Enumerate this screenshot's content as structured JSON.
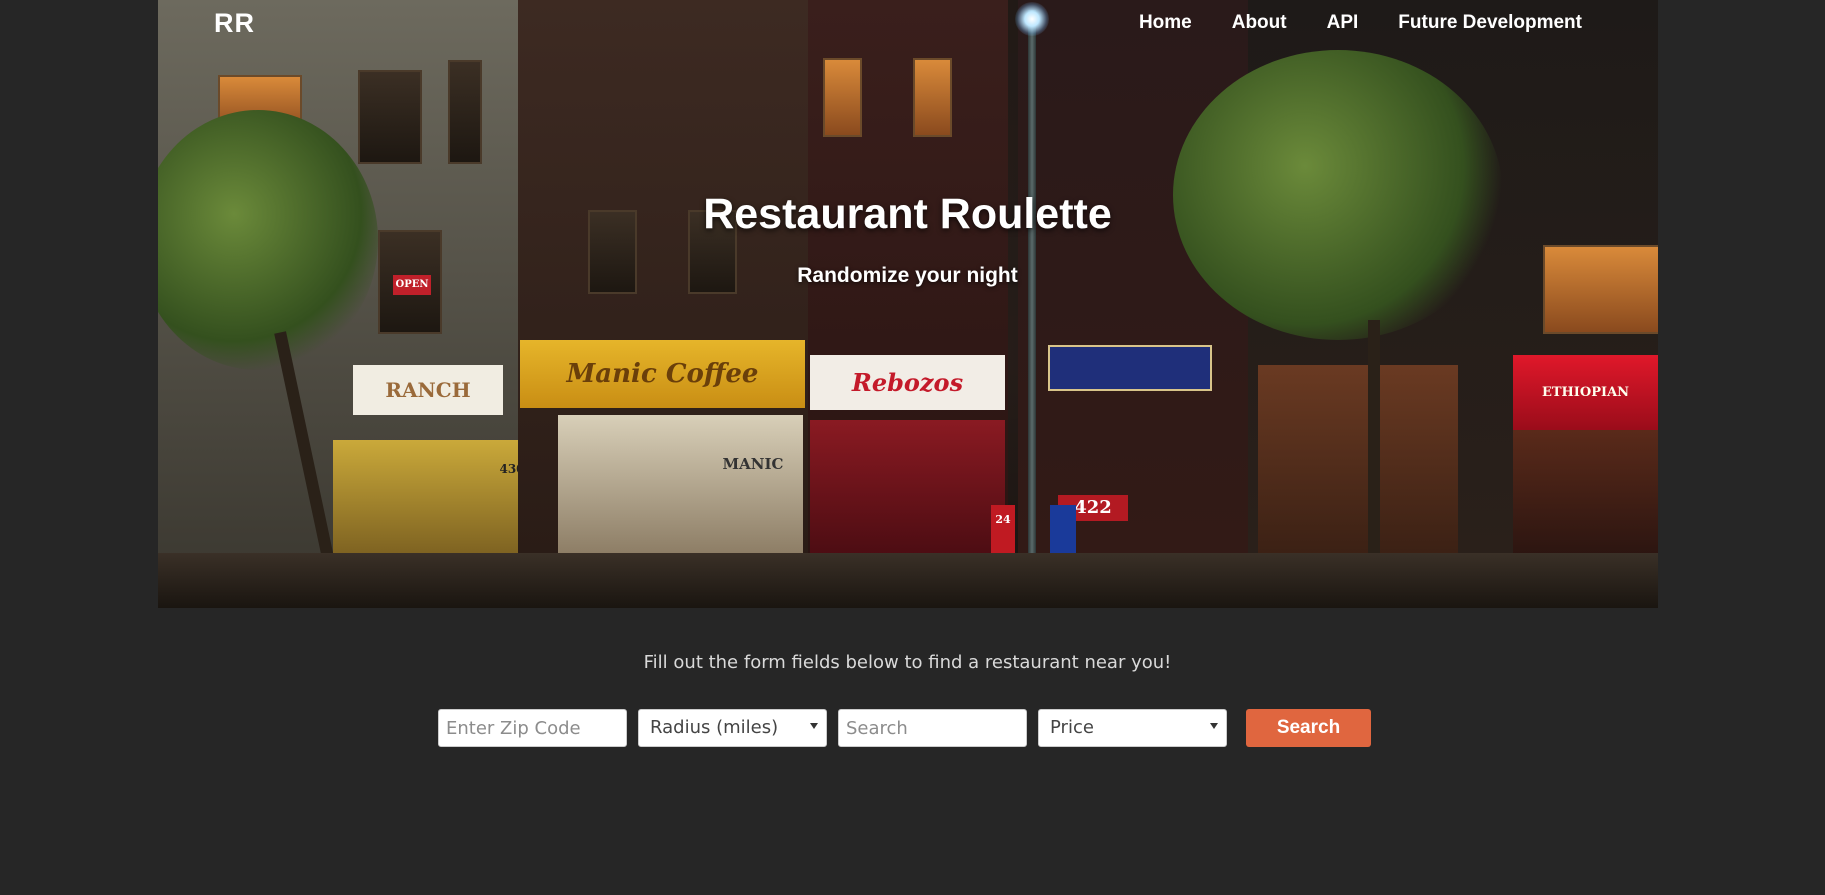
{
  "brand": "RR",
  "nav": {
    "items": [
      {
        "label": "Home"
      },
      {
        "label": "About"
      },
      {
        "label": "API"
      },
      {
        "label": "Future Development"
      }
    ]
  },
  "hero": {
    "title": "Restaurant Roulette",
    "subtitle": "Randomize your night",
    "image_description_icon": "street-photo",
    "signs": [
      "RANCH",
      "Manic Coffee",
      "Rebozos",
      "OPEN",
      "MANIC",
      "ETHIOPIAN",
      "422",
      "430",
      "24"
    ]
  },
  "form": {
    "instructions": "Fill out the form fields below to find a restaurant near you!",
    "zip_placeholder": "Enter Zip Code",
    "radius_selected": "Radius (miles)",
    "search_placeholder": "Search",
    "price_selected": "Price",
    "submit_label": "Search"
  },
  "colors": {
    "background": "#262626",
    "button": "#e0663f",
    "text": "#ffffff"
  }
}
